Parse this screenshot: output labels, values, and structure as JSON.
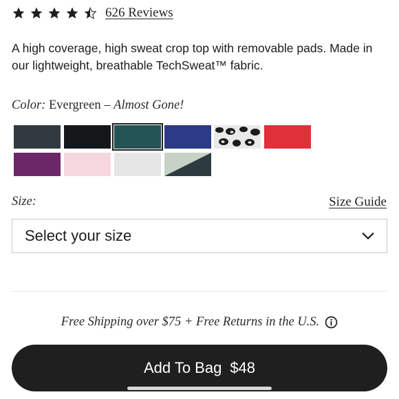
{
  "rating": {
    "value": 4.5,
    "max": 5,
    "reviews_label": "626 Reviews"
  },
  "description": "A high coverage, high sweat crop top with removable pads. Made in our lightweight, breathable TechSweat™ fabric.",
  "color": {
    "label": "Color:",
    "selected": "Evergreen",
    "separator": "–",
    "status": "Almost Gone!"
  },
  "swatches": [
    {
      "name": "swatch-charcoal",
      "colors": [
        "#323a40"
      ]
    },
    {
      "name": "swatch-black",
      "colors": [
        "#15181b"
      ]
    },
    {
      "name": "swatch-evergreen",
      "colors": [
        "#245456"
      ],
      "selected": true
    },
    {
      "name": "swatch-royal-blue",
      "colors": [
        "#2b3b86"
      ]
    },
    {
      "name": "swatch-leopard",
      "colors": [
        "#e9e9e9",
        "#1b1b1b"
      ]
    },
    {
      "name": "swatch-red",
      "colors": [
        "#e03138"
      ]
    },
    {
      "name": "swatch-plum",
      "colors": [
        "#6b2767"
      ]
    },
    {
      "name": "swatch-pale-pink",
      "colors": [
        "#f7d7df"
      ]
    },
    {
      "name": "swatch-light-grey",
      "colors": [
        "#e6e6e6"
      ]
    },
    {
      "name": "swatch-sage-navy",
      "colors": [
        "#c6d2c4",
        "#2d3a40"
      ]
    }
  ],
  "size": {
    "label": "Size:",
    "guide_label": "Size Guide",
    "select_placeholder": "Select your size"
  },
  "shipping_text": "Free Shipping over $75 + Free Returns in the U.S.",
  "add_to_bag": {
    "label": "Add To Bag",
    "price": "$48"
  },
  "icons": {
    "star": "star-icon",
    "half_star": "half-star-icon",
    "chevron": "chevron-down-icon",
    "info": "info-icon"
  }
}
